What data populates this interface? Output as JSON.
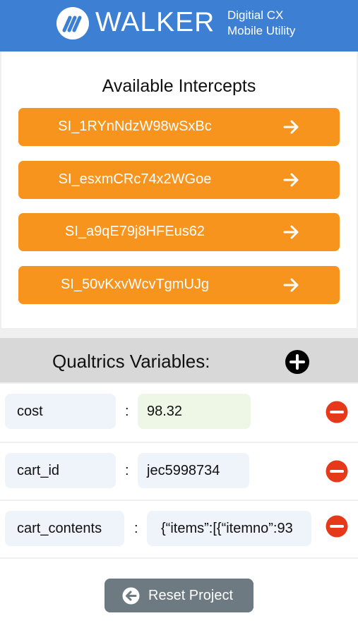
{
  "header": {
    "brand": "WALKER",
    "subtitle_line1": "Digitial CX",
    "subtitle_line2": "Mobile Utility",
    "logo_icon": "walker-logo-icon",
    "color": "#3c7fd3"
  },
  "intercepts": {
    "title": "Available Intercepts",
    "items": [
      {
        "label": "SI_1RYnNdzW98wSxBc"
      },
      {
        "label": "SI_esxmCRc74x2WGoe"
      },
      {
        "label": "SI_a9qE79j8HFEus62"
      },
      {
        "label": "SI_50vKxvWcvTgmUJg"
      }
    ],
    "button_color": "#f7941d",
    "arrow_icon": "arrow-right-icon"
  },
  "variables": {
    "title": "Qualtrics Variables:",
    "add_icon": "plus-circle-icon",
    "remove_icon": "minus-circle-icon",
    "separator": ":",
    "rows": [
      {
        "key": "cost",
        "value": "98.32"
      },
      {
        "key": "cart_id",
        "value": "jec5998734"
      },
      {
        "key": "cart_contents",
        "value": "{“items”:[{“itemno”:93"
      }
    ]
  },
  "footer": {
    "reset_label": "Reset Project",
    "reset_icon": "back-arrow-circle-icon"
  }
}
